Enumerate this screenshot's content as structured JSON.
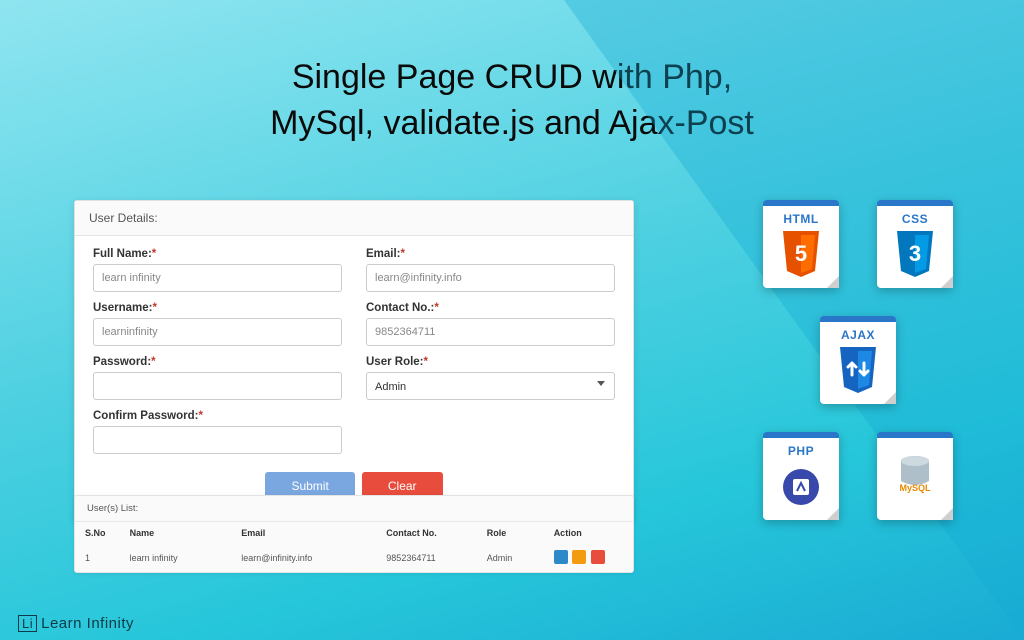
{
  "title_line1": "Single Page CRUD with Php,",
  "title_line2": "MySql, validate.js and Ajax-Post",
  "form": {
    "panel_title": "User Details:",
    "fullname_label": "Full Name:",
    "fullname_value": "learn infinity",
    "email_label": "Email:",
    "email_value": "learn@infinity.info",
    "username_label": "Username:",
    "username_value": "learninfinity",
    "contact_label": "Contact No.:",
    "contact_value": "9852364711",
    "password_label": "Password:",
    "role_label": "User Role:",
    "role_value": "Admin",
    "confirm_label": "Confirm Password:",
    "submit": "Submit",
    "clear": "Clear"
  },
  "list": {
    "title": "User(s) List:",
    "headers": {
      "sno": "S.No",
      "name": "Name",
      "email": "Email",
      "contact": "Contact No.",
      "role": "Role",
      "action": "Action"
    },
    "row": {
      "sno": "1",
      "name": "learn infinity",
      "email": "learn@infinity.info",
      "contact": "9852364711",
      "role": "Admin"
    }
  },
  "tech": {
    "html": "HTML",
    "css": "CSS",
    "ajax": "AJAX",
    "php": "PHP",
    "mysql": ""
  },
  "footer": "Learn Infinity"
}
